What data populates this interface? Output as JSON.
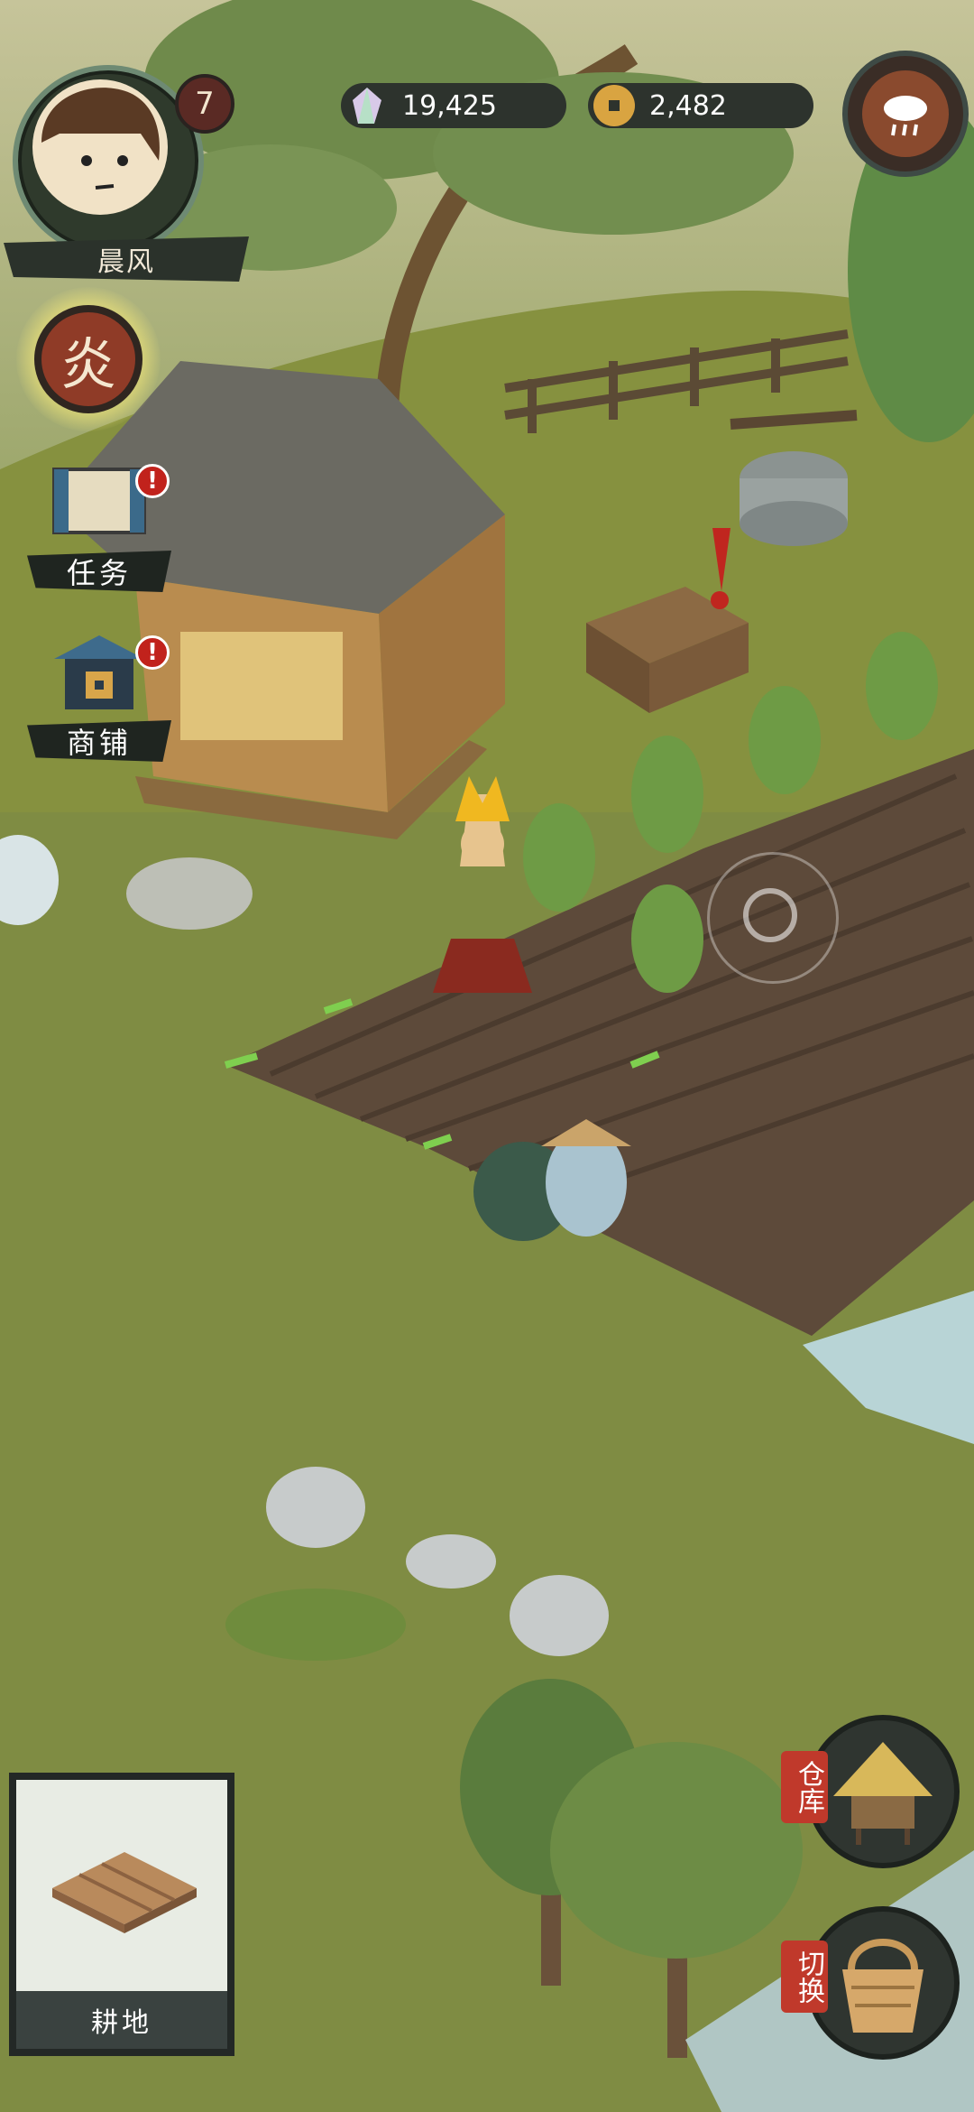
{
  "player": {
    "name": "晨风",
    "level": "7"
  },
  "resources": {
    "crystals": "19,425",
    "coins": "2,482"
  },
  "skill": {
    "glyph": "炎"
  },
  "side_buttons": {
    "quests_label": "任务",
    "shop_label": "商铺"
  },
  "build_card": {
    "title": "耕地"
  },
  "bottom_right": {
    "warehouse_label": "仓库",
    "switch_label": "切换"
  },
  "weather": {
    "icon": "rain-cloud-icon"
  },
  "alert_mark": "!"
}
